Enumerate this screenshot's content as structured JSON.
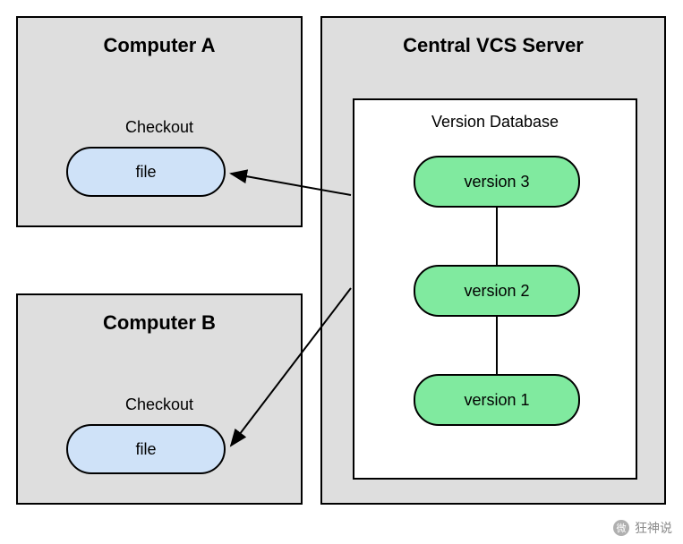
{
  "computer_a": {
    "title": "Computer A",
    "checkout_label": "Checkout",
    "file_label": "file"
  },
  "computer_b": {
    "title": "Computer B",
    "checkout_label": "Checkout",
    "file_label": "file"
  },
  "server": {
    "title": "Central VCS Server",
    "db_label": "Version Database",
    "versions": {
      "v3": "version 3",
      "v2": "version 2",
      "v1": "version 1"
    }
  },
  "watermark": {
    "icon": "微",
    "text": "狂神说"
  }
}
